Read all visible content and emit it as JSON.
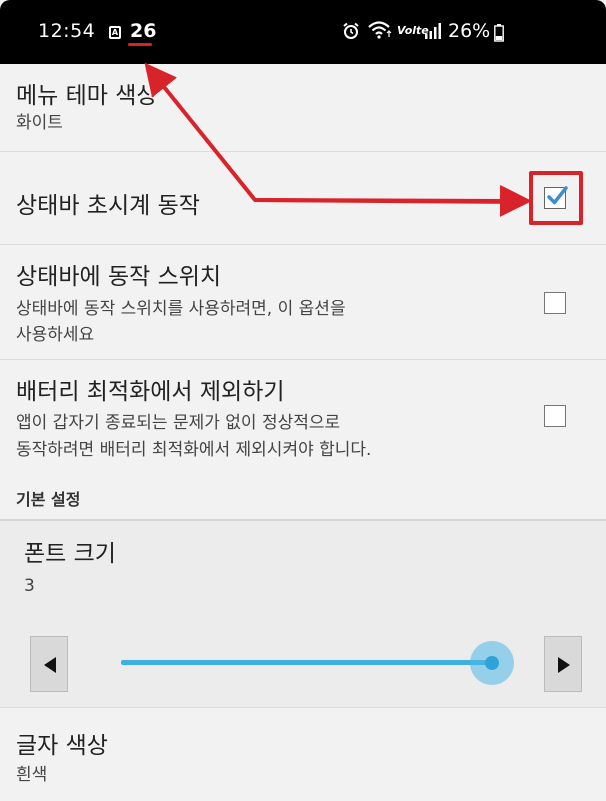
{
  "status_bar": {
    "time": "12:54",
    "app_icon_letter": "A",
    "notification_number": "26",
    "volte_label": "Volte",
    "battery_percent": "26%",
    "icons": [
      "alarm-icon",
      "wifi-icon",
      "signal-icon",
      "battery-icon"
    ]
  },
  "settings": {
    "theme_color": {
      "title": "메뉴 테마 색상",
      "value": "화이트"
    },
    "statusbar_clock": {
      "title": "상태바 초시계 동작",
      "checked": true
    },
    "statusbar_switch": {
      "title": "상태바에 동작 스위치",
      "summary_line1": "상태바에 동작 스위치를 사용하려면, 이 옵션을",
      "summary_line2": "사용하세요",
      "checked": false
    },
    "battery_optimization": {
      "title": "배터리 최적화에서 제외하기",
      "summary_line1": "앱이 갑자기 종료되는 문제가 없이 정상적으로",
      "summary_line2": "동작하려면 배터리 최적화에서 제외시켜야 합니다.",
      "checked": false
    }
  },
  "basic_settings": {
    "header": "기본 설정",
    "font_size": {
      "title": "폰트 크기",
      "value": "3",
      "slider_fraction": 1.0
    },
    "text_color": {
      "title": "글자 색상",
      "value": "흰색"
    }
  },
  "colors": {
    "accent": "#3fb0e2",
    "annotation_red": "#d9232a",
    "checkmark": "#3a8fd0"
  }
}
